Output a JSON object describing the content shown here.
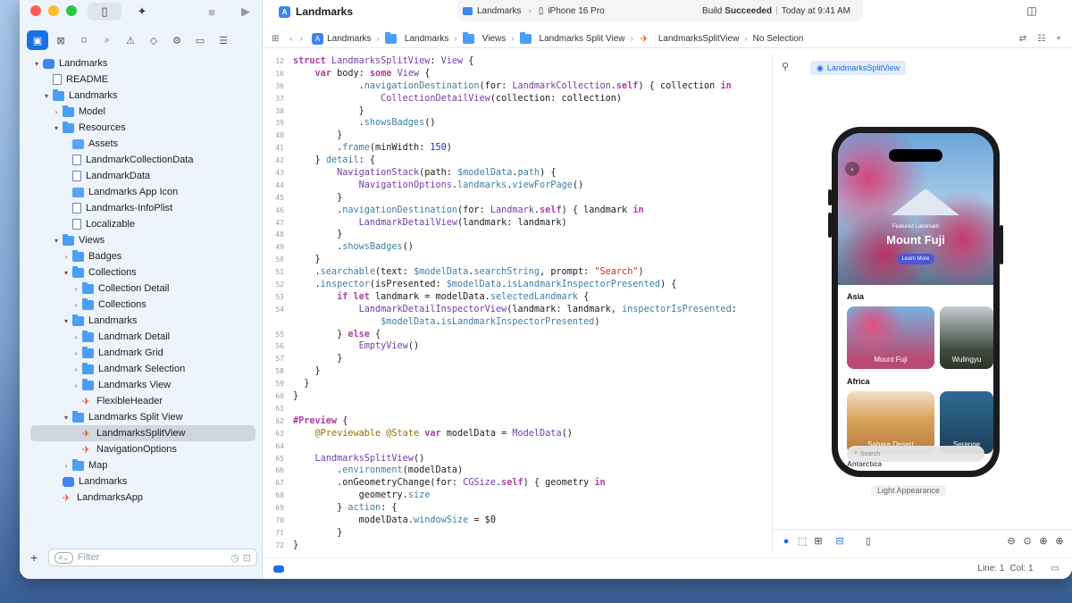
{
  "window": {
    "project_name": "Landmarks"
  },
  "activity": {
    "scheme": "Landmarks",
    "device": "iPhone 16 Pro",
    "build_status": "Build",
    "build_result": "Succeeded",
    "build_time": "Today at 9:41 AM"
  },
  "jumpbar": {
    "crumbs": [
      "Landmarks",
      "Landmarks",
      "Views",
      "Landmarks Split View",
      "LandmarksSplitView",
      "No Selection"
    ]
  },
  "navigator": {
    "filter_placeholder": "Filter",
    "items": [
      {
        "label": "Landmarks",
        "indent": 0,
        "chev": "▾",
        "icon": "app"
      },
      {
        "label": "README",
        "indent": 1,
        "chev": "",
        "icon": "doc"
      },
      {
        "label": "Landmarks",
        "indent": 1,
        "chev": "▾",
        "icon": "folder"
      },
      {
        "label": "Model",
        "indent": 2,
        "chev": "›",
        "icon": "folder"
      },
      {
        "label": "Resources",
        "indent": 2,
        "chev": "▾",
        "icon": "folder"
      },
      {
        "label": "Assets",
        "indent": 3,
        "chev": "",
        "icon": "asset"
      },
      {
        "label": "LandmarkCollectionData",
        "indent": 3,
        "chev": "",
        "icon": "doc"
      },
      {
        "label": "LandmarkData",
        "indent": 3,
        "chev": "",
        "icon": "doc"
      },
      {
        "label": "Landmarks App Icon",
        "indent": 3,
        "chev": "",
        "icon": "asset"
      },
      {
        "label": "Landmarks-InfoPlist",
        "indent": 3,
        "chev": "",
        "icon": "doc"
      },
      {
        "label": "Localizable",
        "indent": 3,
        "chev": "",
        "icon": "doc"
      },
      {
        "label": "Views",
        "indent": 2,
        "chev": "▾",
        "icon": "folder"
      },
      {
        "label": "Badges",
        "indent": 3,
        "chev": "›",
        "icon": "folder"
      },
      {
        "label": "Collections",
        "indent": 3,
        "chev": "▾",
        "icon": "folder"
      },
      {
        "label": "Collection Detail",
        "indent": 4,
        "chev": "›",
        "icon": "folder"
      },
      {
        "label": "Collections",
        "indent": 4,
        "chev": "›",
        "icon": "folder"
      },
      {
        "label": "Landmarks",
        "indent": 3,
        "chev": "▾",
        "icon": "folder"
      },
      {
        "label": "Landmark Detail",
        "indent": 4,
        "chev": "›",
        "icon": "folder"
      },
      {
        "label": "Landmark Grid",
        "indent": 4,
        "chev": "›",
        "icon": "folder"
      },
      {
        "label": "Landmark Selection",
        "indent": 4,
        "chev": "›",
        "icon": "folder"
      },
      {
        "label": "Landmarks View",
        "indent": 4,
        "chev": "›",
        "icon": "folder"
      },
      {
        "label": "FlexibleHeader",
        "indent": 4,
        "chev": "",
        "icon": "swift"
      },
      {
        "label": "Landmarks Split View",
        "indent": 3,
        "chev": "▾",
        "icon": "folder"
      },
      {
        "label": "LandmarksSplitView",
        "indent": 4,
        "chev": "",
        "icon": "swift",
        "selected": true
      },
      {
        "label": "NavigationOptions",
        "indent": 4,
        "chev": "",
        "icon": "swift"
      },
      {
        "label": "Map",
        "indent": 3,
        "chev": "›",
        "icon": "folder"
      },
      {
        "label": "Landmarks",
        "indent": 2,
        "chev": "",
        "icon": "app"
      },
      {
        "label": "LandmarksApp",
        "indent": 2,
        "chev": "",
        "icon": "swift"
      }
    ]
  },
  "code": [
    {
      "n": "12",
      "t": [
        [
          "kw",
          "struct "
        ],
        [
          "ty",
          "LandmarksSplitView"
        ],
        [
          "pl",
          ": "
        ],
        [
          "ty",
          "View"
        ],
        [
          "pl",
          " {"
        ]
      ]
    },
    {
      "n": "16",
      "t": [
        [
          "pl",
          "    "
        ],
        [
          "kw",
          "var "
        ],
        [
          "pl",
          "body: "
        ],
        [
          "kw",
          "some "
        ],
        [
          "ty",
          "View"
        ],
        [
          "pl",
          " {"
        ]
      ]
    },
    {
      "n": "36",
      "t": [
        [
          "pl",
          "            ."
        ],
        [
          "fn",
          "navigationDestination"
        ],
        [
          "pl",
          "(for: "
        ],
        [
          "ty",
          "LandmarkCollection"
        ],
        [
          "pl",
          "."
        ],
        [
          "kw",
          "self"
        ],
        [
          "pl",
          ") { collection "
        ],
        [
          "kw",
          "in"
        ]
      ]
    },
    {
      "n": "37",
      "t": [
        [
          "pl",
          "                "
        ],
        [
          "ty",
          "CollectionDetailView"
        ],
        [
          "pl",
          "(collection: collection)"
        ]
      ]
    },
    {
      "n": "38",
      "t": [
        [
          "pl",
          "            }"
        ]
      ]
    },
    {
      "n": "39",
      "t": [
        [
          "pl",
          "            ."
        ],
        [
          "fn",
          "showsBadges"
        ],
        [
          "pl",
          "()"
        ]
      ]
    },
    {
      "n": "40",
      "t": [
        [
          "pl",
          "        }"
        ]
      ]
    },
    {
      "n": "41",
      "t": [
        [
          "pl",
          "        ."
        ],
        [
          "fn",
          "frame"
        ],
        [
          "pl",
          "(minWidth: "
        ],
        [
          "nm",
          "150"
        ],
        [
          "pl",
          ")"
        ]
      ]
    },
    {
      "n": "42",
      "t": [
        [
          "pl",
          "    } "
        ],
        [
          "fn",
          "detail"
        ],
        [
          "pl",
          ": {"
        ]
      ]
    },
    {
      "n": "43",
      "t": [
        [
          "pl",
          "        "
        ],
        [
          "ty",
          "NavigationStack"
        ],
        [
          "pl",
          "(path: "
        ],
        [
          "fn",
          "$modelData"
        ],
        [
          "pl",
          "."
        ],
        [
          "fn",
          "path"
        ],
        [
          "pl",
          ") {"
        ]
      ]
    },
    {
      "n": "44",
      "t": [
        [
          "pl",
          "            "
        ],
        [
          "ty",
          "NavigationOptions"
        ],
        [
          "pl",
          "."
        ],
        [
          "fn",
          "landmarks"
        ],
        [
          "pl",
          "."
        ],
        [
          "fn",
          "viewForPage"
        ],
        [
          "pl",
          "()"
        ]
      ]
    },
    {
      "n": "45",
      "t": [
        [
          "pl",
          "        }"
        ]
      ]
    },
    {
      "n": "46",
      "t": [
        [
          "pl",
          "        ."
        ],
        [
          "fn",
          "navigationDestination"
        ],
        [
          "pl",
          "(for: "
        ],
        [
          "ty",
          "Landmark"
        ],
        [
          "pl",
          "."
        ],
        [
          "kw",
          "self"
        ],
        [
          "pl",
          ") { landmark "
        ],
        [
          "kw",
          "in"
        ]
      ]
    },
    {
      "n": "47",
      "t": [
        [
          "pl",
          "            "
        ],
        [
          "ty",
          "LandmarkDetailView"
        ],
        [
          "pl",
          "(landmark: landmark)"
        ]
      ]
    },
    {
      "n": "48",
      "t": [
        [
          "pl",
          "        }"
        ]
      ]
    },
    {
      "n": "49",
      "t": [
        [
          "pl",
          "        ."
        ],
        [
          "fn",
          "showsBadges"
        ],
        [
          "pl",
          "()"
        ]
      ]
    },
    {
      "n": "50",
      "t": [
        [
          "pl",
          "    }"
        ]
      ]
    },
    {
      "n": "51",
      "t": [
        [
          "pl",
          "    ."
        ],
        [
          "fn",
          "searchable"
        ],
        [
          "pl",
          "(text: "
        ],
        [
          "fn",
          "$modelData"
        ],
        [
          "pl",
          "."
        ],
        [
          "fn",
          "searchString"
        ],
        [
          "pl",
          ", prompt: "
        ],
        [
          "st",
          "\"Search\""
        ],
        [
          "pl",
          ")"
        ]
      ]
    },
    {
      "n": "52",
      "t": [
        [
          "pl",
          "    ."
        ],
        [
          "fn",
          "inspector"
        ],
        [
          "pl",
          "(isPresented: "
        ],
        [
          "fn",
          "$modelData"
        ],
        [
          "pl",
          "."
        ],
        [
          "fn",
          "isLandmarkInspectorPresented"
        ],
        [
          "pl",
          ") {"
        ]
      ]
    },
    {
      "n": "53",
      "t": [
        [
          "pl",
          "        "
        ],
        [
          "kw",
          "if let "
        ],
        [
          "pl",
          "landmark = modelData."
        ],
        [
          "fn",
          "selectedLandmark"
        ],
        [
          "pl",
          " {"
        ]
      ]
    },
    {
      "n": "54",
      "t": [
        [
          "pl",
          "            "
        ],
        [
          "ty",
          "LandmarkDetailInspectorView"
        ],
        [
          "pl",
          "(landmark: landmark, "
        ],
        [
          "fn",
          "inspectorIsPresented"
        ],
        [
          "pl",
          ":"
        ]
      ]
    },
    {
      "n": "",
      "t": [
        [
          "pl",
          "                "
        ],
        [
          "fn",
          "$modelData"
        ],
        [
          "pl",
          "."
        ],
        [
          "fn",
          "isLandmarkInspectorPresented"
        ],
        [
          "pl",
          ")"
        ]
      ]
    },
    {
      "n": "55",
      "t": [
        [
          "pl",
          "        } "
        ],
        [
          "kw",
          "else"
        ],
        [
          "pl",
          " {"
        ]
      ]
    },
    {
      "n": "56",
      "t": [
        [
          "pl",
          "            "
        ],
        [
          "ty",
          "EmptyView"
        ],
        [
          "pl",
          "()"
        ]
      ]
    },
    {
      "n": "57",
      "t": [
        [
          "pl",
          "        }"
        ]
      ]
    },
    {
      "n": "58",
      "t": [
        [
          "pl",
          "    }"
        ]
      ]
    },
    {
      "n": "59",
      "t": [
        [
          "pl",
          "  }"
        ]
      ]
    },
    {
      "n": "60",
      "t": [
        [
          "pl",
          "}"
        ]
      ]
    },
    {
      "n": "61",
      "t": [
        [
          "pl",
          ""
        ]
      ]
    },
    {
      "n": "62",
      "t": [
        [
          "kw",
          "#Preview"
        ],
        [
          "pl",
          " {"
        ]
      ]
    },
    {
      "n": "63",
      "t": [
        [
          "pl",
          "    "
        ],
        [
          "at",
          "@Previewable @State "
        ],
        [
          "kw",
          "var "
        ],
        [
          "pl",
          "modelData = "
        ],
        [
          "ty",
          "ModelData"
        ],
        [
          "pl",
          "()"
        ]
      ]
    },
    {
      "n": "64",
      "t": [
        [
          "pl",
          ""
        ]
      ]
    },
    {
      "n": "65",
      "t": [
        [
          "pl",
          "    "
        ],
        [
          "ty",
          "LandmarksSplitView"
        ],
        [
          "pl",
          "()"
        ]
      ]
    },
    {
      "n": "66",
      "t": [
        [
          "pl",
          "        ."
        ],
        [
          "fn",
          "environment"
        ],
        [
          "pl",
          "(modelData)"
        ]
      ]
    },
    {
      "n": "67",
      "t": [
        [
          "pl",
          "        .onGeometryChange(for: "
        ],
        [
          "ty",
          "CGSize"
        ],
        [
          "pl",
          "."
        ],
        [
          "kw",
          "self"
        ],
        [
          "pl",
          ") { geometry "
        ],
        [
          "kw",
          "in"
        ]
      ]
    },
    {
      "n": "68",
      "t": [
        [
          "pl",
          "            geometry."
        ],
        [
          "fn",
          "size"
        ]
      ]
    },
    {
      "n": "69",
      "t": [
        [
          "pl",
          "        } "
        ],
        [
          "fn",
          "action"
        ],
        [
          "pl",
          ": {"
        ]
      ]
    },
    {
      "n": "70",
      "t": [
        [
          "pl",
          "            modelData."
        ],
        [
          "fn",
          "windowSize"
        ],
        [
          "pl",
          " = $0"
        ]
      ]
    },
    {
      "n": "71",
      "t": [
        [
          "pl",
          "        }"
        ]
      ]
    },
    {
      "n": "72",
      "t": [
        [
          "pl",
          "}"
        ]
      ]
    }
  ],
  "preview": {
    "target_label": "LandmarksSplitView",
    "featured_label": "Featured Landmark",
    "featured_title": "Mount Fuji",
    "learn_more": "Learn More",
    "section_asia": "Asia",
    "asia_cards": [
      "Mount Fuji",
      "Wulingyu"
    ],
    "section_africa": "Africa",
    "africa_cards": [
      "Sahara Desert",
      "Serenge"
    ],
    "section_antarctica": "Antarctica",
    "search_placeholder": "Search",
    "appearance": "Light Appearance"
  },
  "status": {
    "line": "Line: 1",
    "col": "Col: 1"
  }
}
